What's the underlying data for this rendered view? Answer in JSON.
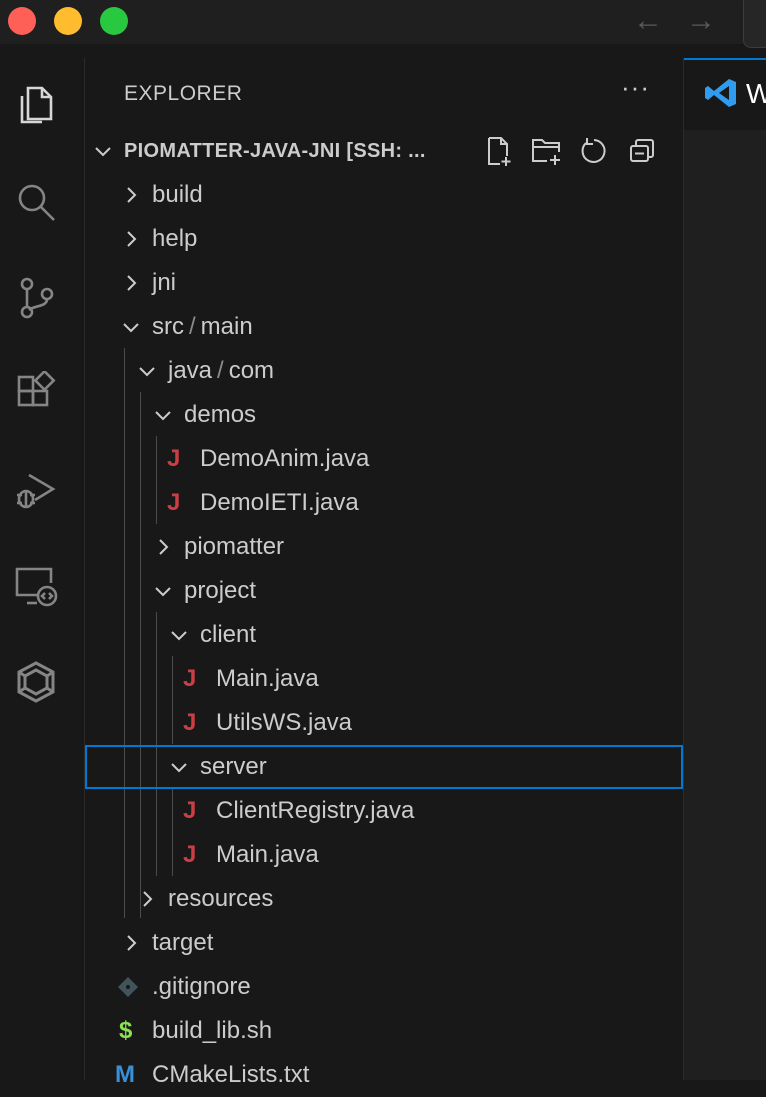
{
  "window": {
    "nav_back": "←",
    "nav_forward": "→"
  },
  "activity_bar": [
    {
      "icon": "files-icon"
    },
    {
      "icon": "search-icon"
    },
    {
      "icon": "source-control-icon"
    },
    {
      "icon": "extensions-icon"
    },
    {
      "icon": "run-debug-icon"
    },
    {
      "icon": "remote-explorer-icon"
    },
    {
      "icon": "extension-hexagon-icon"
    }
  ],
  "explorer": {
    "title": "EXPLORER",
    "more": "···",
    "project": "PIOMATTER-JAVA-JNI [SSH: ...",
    "tree": {
      "build": "build",
      "help": "help",
      "jni": "jni",
      "src": "src",
      "main": "main",
      "java": "java",
      "com": "com",
      "demos": "demos",
      "demoanim": "DemoAnim.java",
      "demoieti": "DemoIETI.java",
      "piomatter": "piomatter",
      "project": "project",
      "client": "client",
      "client_main": "Main.java",
      "utilsws": "UtilsWS.java",
      "server": "server",
      "clientregistry": "ClientRegistry.java",
      "server_main": "Main.java",
      "resources": "resources",
      "target": "target",
      "gitignore": ".gitignore",
      "build_lib": "build_lib.sh",
      "cmakelists": "CMakeLists.txt"
    },
    "icons": {
      "java_glyph": "J",
      "shell_glyph": "$",
      "cmake_glyph": "M",
      "separator": "/"
    }
  },
  "editor": {
    "tab_label": "W"
  },
  "colors": {
    "accent": "#0078d4",
    "java": "#cc3e44",
    "shell": "#89e051",
    "cmake": "#3a8fd6",
    "git": "#41535b"
  }
}
